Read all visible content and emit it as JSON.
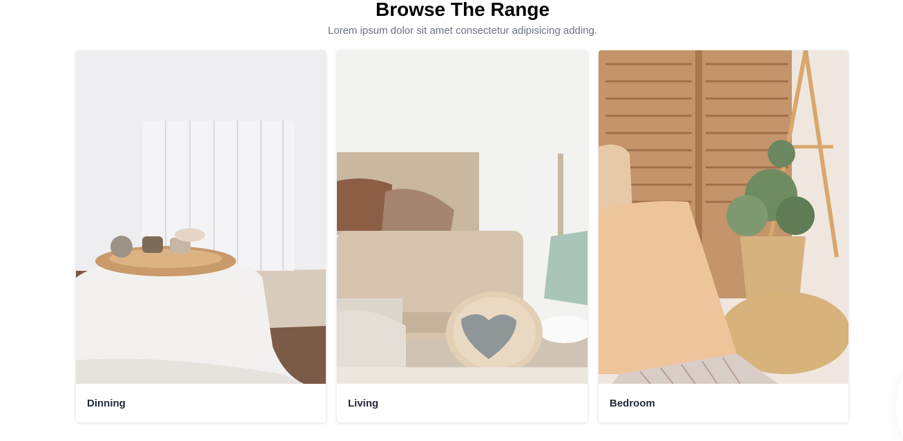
{
  "section": {
    "title": "Browse The Range",
    "subtitle": "Lorem ipsum dolor sit amet consectetur adipisicing adding."
  },
  "cards": [
    {
      "label": "Dinning",
      "image": "dining-room-photo"
    },
    {
      "label": "Living",
      "image": "living-room-photo"
    },
    {
      "label": "Bedroom",
      "image": "bedroom-photo"
    }
  ]
}
